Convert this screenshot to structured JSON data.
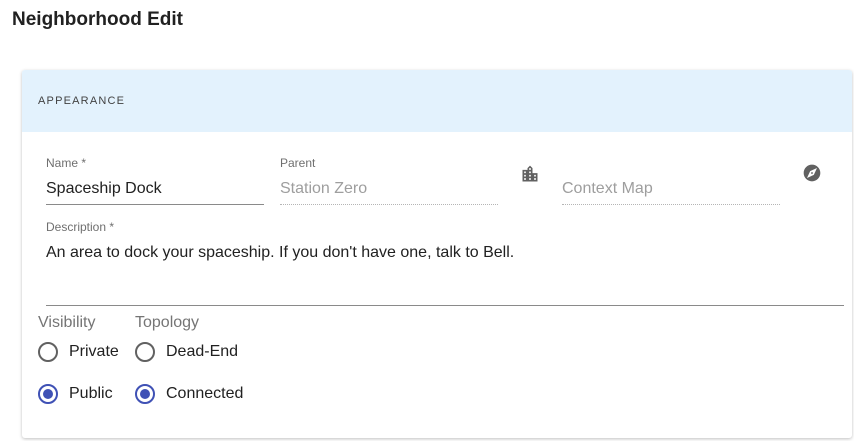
{
  "page": {
    "title": "Neighborhood Edit"
  },
  "appearance": {
    "section_label": "APPEARANCE",
    "name": {
      "label": "Name *",
      "value": "Spaceship Dock"
    },
    "parent": {
      "label": "Parent",
      "value": "Station Zero",
      "icon": "city-icon"
    },
    "context_map": {
      "placeholder": "Context Map",
      "icon": "compass-icon"
    },
    "description": {
      "label": "Description *",
      "value": "An area to dock your spaceship. If you don't have one, talk to Bell."
    },
    "visibility": {
      "label": "Visibility",
      "options": [
        {
          "label": "Private",
          "checked": false
        },
        {
          "label": "Public",
          "checked": true
        }
      ]
    },
    "topology": {
      "label": "Topology",
      "options": [
        {
          "label": "Dead-End",
          "checked": false
        },
        {
          "label": "Connected",
          "checked": true
        }
      ]
    }
  },
  "colors": {
    "accent": "#3f51b5",
    "header_bg": "#e3f2fd"
  }
}
